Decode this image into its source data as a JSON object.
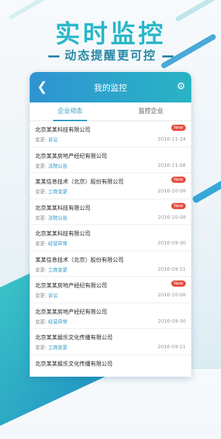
{
  "promo": {
    "headline": "实时监控",
    "subline": "动态提醒更可控"
  },
  "colors": {
    "accent": "#2a97c4",
    "badge": "#e84c3d",
    "headline": "#29b7c8"
  },
  "appbar": {
    "title": "我的监控",
    "back_icon": "chevron-left-icon",
    "settings_icon": "gear-icon"
  },
  "tabs": [
    {
      "label": "企业动态",
      "active": true
    },
    {
      "label": "监控企业",
      "active": false
    }
  ],
  "list": {
    "change_prefix": "变更:",
    "items": [
      {
        "company": "北京某某科技有限公司",
        "change": "诉讼",
        "date": "2016-11-24",
        "badge": "New"
      },
      {
        "company": "北京某某房地产经纪有限公司",
        "change": "法院公告",
        "date": "2016-11-08",
        "badge": ""
      },
      {
        "company": "某某信息技术（北京）股份有限公司",
        "change": "工商变更",
        "date": "2016-10-08",
        "badge": "New"
      },
      {
        "company": "北京某某科技有限公司",
        "change": "法院公告",
        "date": "2016-10-08",
        "badge": "New"
      },
      {
        "company": "北京某某科技有限公司",
        "change": "经营异常",
        "date": "2016-09-30",
        "badge": ""
      },
      {
        "company": "某某信息技术（北京）股份有限公司",
        "change": "工商变更",
        "date": "2016-09-21",
        "badge": ""
      },
      {
        "company": "北京某某房地产经纪有限公司",
        "change": "诉讼",
        "date": "2016-10-08",
        "badge": "New"
      },
      {
        "company": "北京某某房地产经纪有限公司",
        "change": "经营异常",
        "date": "2016-09-30",
        "badge": ""
      },
      {
        "company": "北京某某娱乐文化传播有限公司",
        "change": "工商变更",
        "date": "2016-09-21",
        "badge": ""
      },
      {
        "company": "北京某某娱乐文化传播有限公司",
        "change": "",
        "date": "",
        "badge": ""
      }
    ]
  }
}
